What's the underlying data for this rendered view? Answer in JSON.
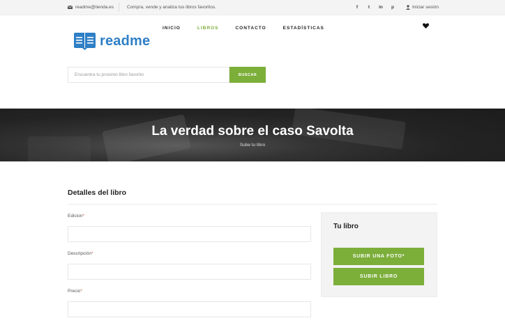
{
  "topbar": {
    "email": "readme@tienda.es",
    "tagline": "Compra, vende y analiza tus libros favoritos.",
    "social": [
      "f",
      "t",
      "in",
      "p"
    ],
    "login": "Iniciar sesión"
  },
  "logo": {
    "name": "readme"
  },
  "nav": {
    "items": [
      "INICIO",
      "LIBROS",
      "CONTACTO",
      "ESTADÍSTICAS"
    ],
    "active": "LIBROS"
  },
  "search": {
    "placeholder": "Encuentra tu proximo libro favorito",
    "value": "",
    "button": "BUSCAR"
  },
  "hero": {
    "title": "La verdad sobre el caso Savolta",
    "subtitle": "Sube tu libro"
  },
  "form": {
    "title": "Detalles del libro",
    "fields": [
      {
        "label": "Edicion",
        "required_mark": "*",
        "value": ""
      },
      {
        "label": "Descripción",
        "required_mark": "*",
        "value": ""
      },
      {
        "label": "Precio",
        "required_mark": "*",
        "value": ""
      }
    ]
  },
  "panel": {
    "title": "Tu libro",
    "upload_photo": "SUBIR UNA FOTO*",
    "upload_book": "SUBIR LIBRO"
  },
  "colors": {
    "accent": "#7cae3a",
    "brand": "#2f7fc6",
    "hero_bg": "#232323"
  },
  "icons": [
    "envelope-icon",
    "facebook-icon",
    "twitter-icon",
    "linkedin-icon",
    "pinterest-icon",
    "user-icon",
    "book-logo-icon",
    "heart-icon"
  ]
}
